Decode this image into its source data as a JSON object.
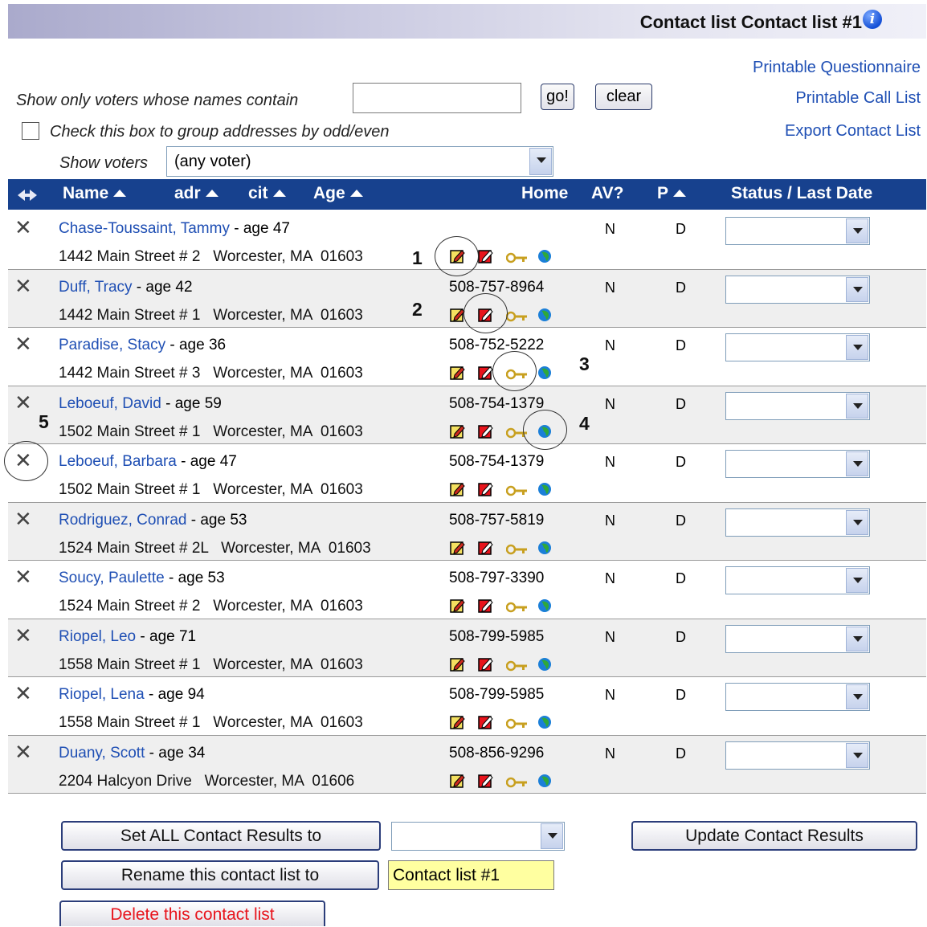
{
  "header": {
    "title": "Contact list Contact list #1",
    "info_icon": "info-icon"
  },
  "links": {
    "printable_questionnaire": "Printable Questionnaire",
    "printable_call_list": "Printable Call List",
    "export_contact_list": "Export Contact List"
  },
  "filter": {
    "label": "Show only voters whose names contain",
    "value": "",
    "go_label": "go!",
    "clear_label": "clear",
    "group_label": "Check this box to group addresses by odd/even",
    "group_checked": false,
    "show_voters_label": "Show voters",
    "show_voters_value": "(any voter)"
  },
  "columns": {
    "name": "Name",
    "adr": "adr",
    "cit": "cit",
    "age": "Age",
    "home": "Home",
    "av": "AV?",
    "p": "P",
    "status": "Status / Last Date"
  },
  "rows": [
    {
      "name": "Chase-Toussaint, Tammy",
      "age": " - age 47",
      "address": "1442 Main Street # 2   Worcester, MA  01603",
      "phone": "",
      "av": "N",
      "party": "D"
    },
    {
      "name": "Duff, Tracy",
      "age": " - age 42",
      "address": "1442 Main Street # 1   Worcester, MA  01603",
      "phone": "508-757-8964",
      "av": "N",
      "party": "D"
    },
    {
      "name": "Paradise, Stacy",
      "age": " - age 36",
      "address": "1442 Main Street # 3   Worcester, MA  01603",
      "phone": "508-752-5222",
      "av": "N",
      "party": "D"
    },
    {
      "name": "Leboeuf, David",
      "age": " - age 59",
      "address": "1502 Main Street # 1   Worcester, MA  01603",
      "phone": "508-754-1379",
      "av": "N",
      "party": "D"
    },
    {
      "name": "Leboeuf, Barbara",
      "age": " - age 47",
      "address": "1502 Main Street # 1   Worcester, MA  01603",
      "phone": "508-754-1379",
      "av": "N",
      "party": "D"
    },
    {
      "name": "Rodriguez, Conrad",
      "age": " - age 53",
      "address": "1524 Main Street # 2L   Worcester, MA  01603",
      "phone": "508-757-5819",
      "av": "N",
      "party": "D"
    },
    {
      "name": "Soucy, Paulette",
      "age": " - age 53",
      "address": "1524 Main Street # 2   Worcester, MA  01603",
      "phone": "508-797-3390",
      "av": "N",
      "party": "D"
    },
    {
      "name": "Riopel, Leo",
      "age": " - age 71",
      "address": "1558 Main Street # 1   Worcester, MA  01603",
      "phone": "508-799-5985",
      "av": "N",
      "party": "D"
    },
    {
      "name": "Riopel, Lena",
      "age": " - age 94",
      "address": "1558 Main Street # 1   Worcester, MA  01603",
      "phone": "508-799-5985",
      "av": "N",
      "party": "D"
    },
    {
      "name": "Duany, Scott",
      "age": " - age 34",
      "address": "2204 Halcyon Drive   Worcester, MA  01606",
      "phone": "508-856-9296",
      "av": "N",
      "party": "D"
    }
  ],
  "annotations": [
    "1",
    "2",
    "3",
    "4",
    "5"
  ],
  "footer": {
    "set_all_label": "Set ALL Contact Results to",
    "set_all_value": "",
    "update_label": "Update Contact Results",
    "rename_label": "Rename this contact list to",
    "rename_value": "Contact list #1",
    "delete_label": "Delete this contact list"
  },
  "colors": {
    "header_bar": "#17418e",
    "link": "#1f4fb4",
    "delete_text": "#e8141c",
    "rename_field": "#ffffa0"
  }
}
